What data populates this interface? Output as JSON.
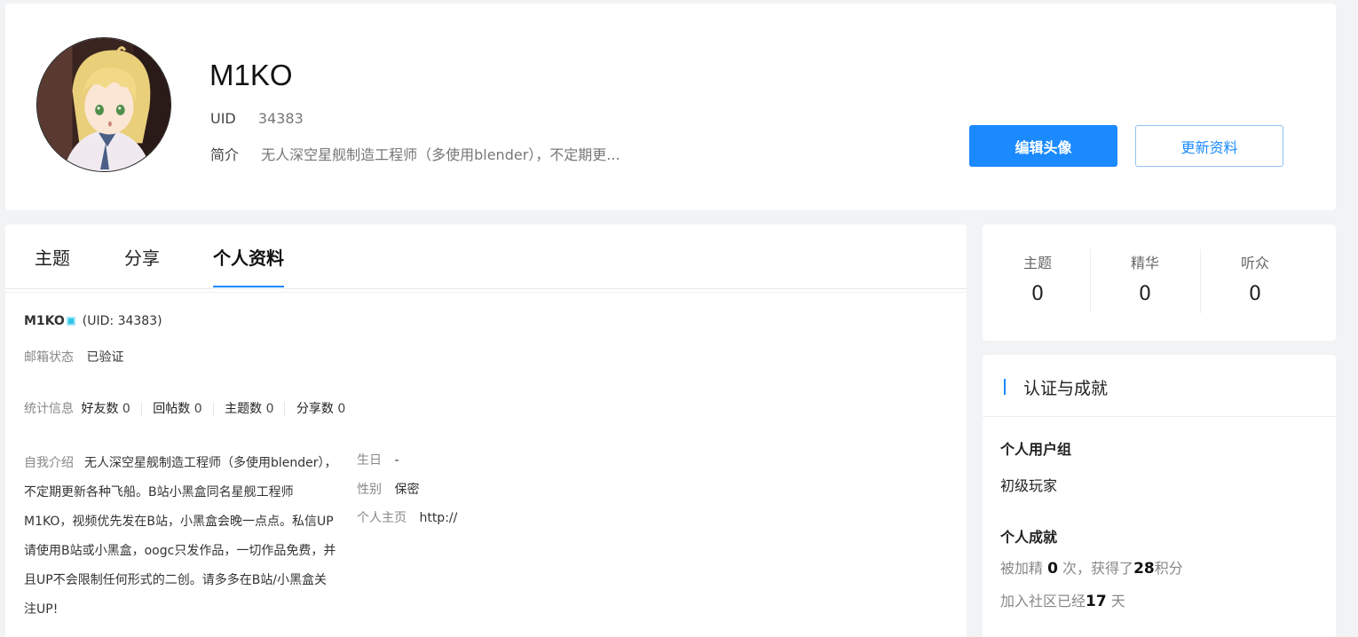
{
  "profile": {
    "username": "M1KO",
    "uid_label": "UID",
    "uid_value": "34383",
    "bio_label": "简介",
    "bio_value": "无人深空星舰制造工程师（多使用blender），不定期更...",
    "edit_avatar_label": "编辑头像",
    "update_profile_label": "更新资料",
    "avatar_icon": "avatar-image"
  },
  "tabs": [
    {
      "label": "主题"
    },
    {
      "label": "分享"
    },
    {
      "label": "个人资料",
      "active": true
    }
  ],
  "details": {
    "name": "M1KO",
    "uid_text": "(UID: 34383)",
    "email_label": "邮箱状态",
    "email_value": "已验证",
    "stats_label": "统计信息",
    "stats": [
      {
        "label": "好友数",
        "value": "0"
      },
      {
        "label": "回帖数",
        "value": "0"
      },
      {
        "label": "主题数",
        "value": "0"
      },
      {
        "label": "分享数",
        "value": "0"
      }
    ],
    "intro_label": "自我介绍",
    "intro_lines": [
      "无人深空星舰制造工程师（多使用blender），",
      "不定期更新各种飞船。B站小黑盒同名星舰工程师",
      "M1KO，视频优先发在B站，小黑盒会晚一点点。私信UP",
      "请使用B站或小黑盒，oogc只发作品，一切作品免费，并",
      "且UP不会限制任何形式的二创。请多多在B站/小黑盒关",
      "注UP!"
    ],
    "birthday_label": "生日",
    "birthday_value": "-",
    "gender_label": "性别",
    "gender_value": "保密",
    "homepage_label": "个人主页",
    "homepage_value": "http://"
  },
  "counters": [
    {
      "label": "主题",
      "value": "0"
    },
    {
      "label": "精华",
      "value": "0"
    },
    {
      "label": "听众",
      "value": "0"
    }
  ],
  "achievements": {
    "title": "认证与成就",
    "group_title": "个人用户组",
    "group_value": "初级玩家",
    "ach_title": "个人成就",
    "digest_prefix": "被加精",
    "digest_count": "0",
    "digest_mid": "次，获得了",
    "points": "28",
    "points_suffix": "积分",
    "joined_prefix": "加入社区已经",
    "joined_days": "17",
    "joined_suffix": "天"
  },
  "colors": {
    "accent": "#1b8aff",
    "online": "#2fc3e8"
  }
}
